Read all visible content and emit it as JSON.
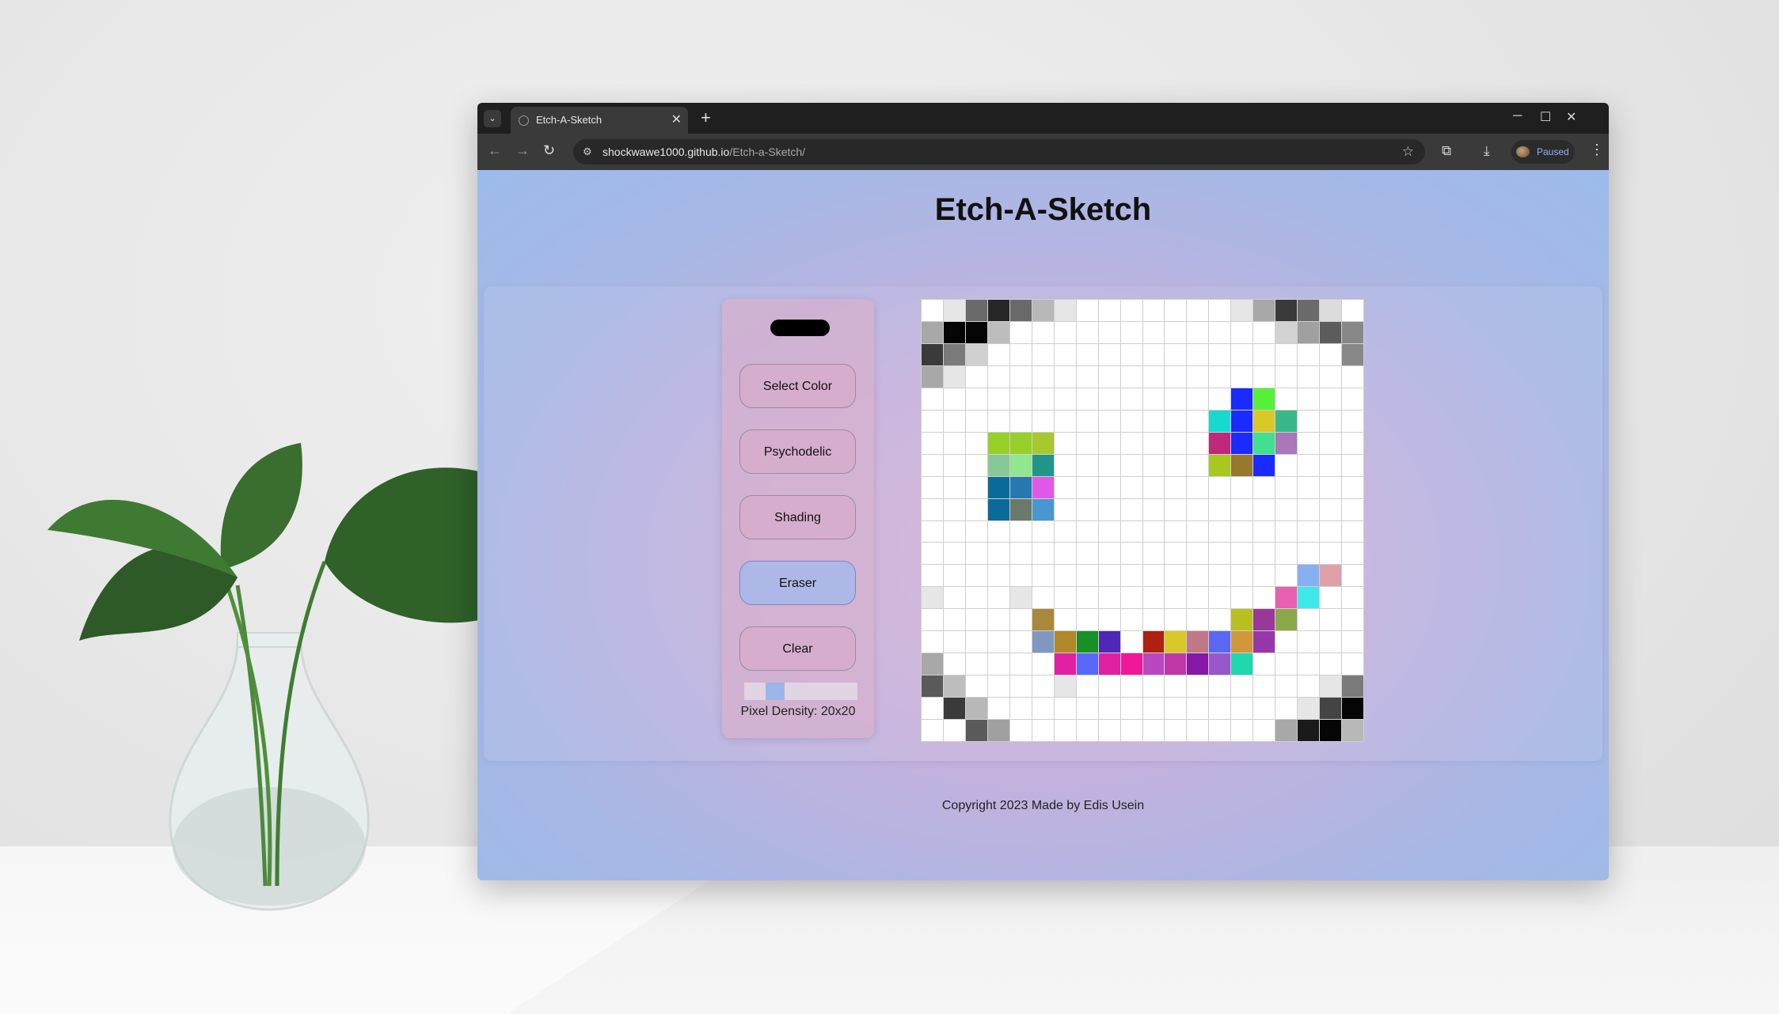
{
  "browser": {
    "tab_title": "Etch-A-Sketch",
    "url_host": "shockwawe1000.github.io",
    "url_path": "/Etch-a-Sketch/",
    "profile_label": "Paused"
  },
  "page": {
    "title": "Etch-A-Sketch",
    "current_color": "#000000",
    "buttons": {
      "select_color": "Select Color",
      "psychodelic": "Psychodelic",
      "shading": "Shading",
      "eraser": "Eraser",
      "clear": "Clear"
    },
    "active_mode": "Eraser",
    "slider_value": 20,
    "density_label": "Pixel Density: 20x20",
    "footer": "Copyright 2023 Made by Edis Usein"
  },
  "grid": {
    "size": 20,
    "cells": [
      [
        "r0",
        "c0",
        "#ffffff"
      ],
      [
        "r0",
        "c1",
        "#e6e6e6"
      ],
      [
        "r0",
        "c2",
        "#6a6a6a"
      ],
      [
        "r0",
        "c3",
        "#262626"
      ],
      [
        "r0",
        "c4",
        "#6a6a6a"
      ],
      [
        "r0",
        "c5",
        "#b8b8b8"
      ],
      [
        "r0",
        "c6",
        "#e6e6e6"
      ],
      [
        "r0",
        "c14",
        "#e6e6e6"
      ],
      [
        "r0",
        "c15",
        "#a8a8a8"
      ],
      [
        "r0",
        "c16",
        "#3a3a3a"
      ],
      [
        "r0",
        "c17",
        "#6a6a6a"
      ],
      [
        "r0",
        "c18",
        "#dcdcdc"
      ],
      [
        "r1",
        "c0",
        "#a8a8a8"
      ],
      [
        "r1",
        "c1",
        "#050505"
      ],
      [
        "r1",
        "c2",
        "#050505"
      ],
      [
        "r1",
        "c3",
        "#bdbdbd"
      ],
      [
        "r1",
        "c16",
        "#d2d2d2"
      ],
      [
        "r1",
        "c17",
        "#a0a0a0"
      ],
      [
        "r1",
        "c18",
        "#5c5c5c"
      ],
      [
        "r1",
        "c19",
        "#888888"
      ],
      [
        "r2",
        "c0",
        "#3a3a3a"
      ],
      [
        "r2",
        "c1",
        "#7a7a7a"
      ],
      [
        "r2",
        "c2",
        "#d0d0d0"
      ],
      [
        "r2",
        "c19",
        "#888888"
      ],
      [
        "r3",
        "c0",
        "#a8a8a8"
      ],
      [
        "r3",
        "c1",
        "#e6e6e6"
      ],
      [
        "r4",
        "c14",
        "#1a2bff"
      ],
      [
        "r4",
        "c15",
        "#57f03a"
      ],
      [
        "r5",
        "c13",
        "#18d8d0"
      ],
      [
        "r5",
        "c14",
        "#1a2bff"
      ],
      [
        "r5",
        "c15",
        "#d8c828"
      ],
      [
        "r5",
        "c16",
        "#3ab88a"
      ],
      [
        "r6",
        "c3",
        "#98d02a"
      ],
      [
        "r6",
        "c4",
        "#98d02a"
      ],
      [
        "r6",
        "c5",
        "#a8c830"
      ],
      [
        "r6",
        "c13",
        "#c0287a"
      ],
      [
        "r6",
        "c14",
        "#1a2bff"
      ],
      [
        "r6",
        "c15",
        "#40e090"
      ],
      [
        "r6",
        "c16",
        "#a878b8"
      ],
      [
        "r7",
        "c3",
        "#88c898"
      ],
      [
        "r7",
        "c4",
        "#90e890"
      ],
      [
        "r7",
        "c5",
        "#20968a"
      ],
      [
        "r7",
        "c13",
        "#a8c820"
      ],
      [
        "r7",
        "c14",
        "#98782a"
      ],
      [
        "r7",
        "c15",
        "#1a2bff"
      ],
      [
        "r8",
        "c3",
        "#0a6a9a"
      ],
      [
        "r8",
        "c4",
        "#2878b0"
      ],
      [
        "r8",
        "c5",
        "#e058e8"
      ],
      [
        "r9",
        "c3",
        "#0a6a9a"
      ],
      [
        "r9",
        "c4",
        "#6a7a6a"
      ],
      [
        "r9",
        "c5",
        "#4898d0"
      ],
      [
        "r12",
        "c17",
        "#88b0f0"
      ],
      [
        "r12",
        "c18",
        "#e0a0a8"
      ],
      [
        "r13",
        "c0",
        "#e6e6e6"
      ],
      [
        "r13",
        "c4",
        "#e6e6e6"
      ],
      [
        "r13",
        "c16",
        "#e860b0"
      ],
      [
        "r13",
        "c17",
        "#40e8e8"
      ],
      [
        "r14",
        "c5",
        "#a8883a"
      ],
      [
        "r14",
        "c14",
        "#b8c020"
      ],
      [
        "r14",
        "c15",
        "#9a389a"
      ],
      [
        "r14",
        "c16",
        "#8aa848"
      ],
      [
        "r15",
        "c5",
        "#8098c0"
      ],
      [
        "r15",
        "c6",
        "#b0882a"
      ],
      [
        "r15",
        "c7",
        "#189028"
      ],
      [
        "r15",
        "c8",
        "#5028b8"
      ],
      [
        "r15",
        "c10",
        "#b02010"
      ],
      [
        "r15",
        "c11",
        "#d8c828"
      ],
      [
        "r15",
        "c12",
        "#c07888"
      ],
      [
        "r15",
        "c13",
        "#5868f0"
      ],
      [
        "r15",
        "c14",
        "#d09838"
      ],
      [
        "r15",
        "c15",
        "#9838a8"
      ],
      [
        "r16",
        "c0",
        "#a8a8a8"
      ],
      [
        "r16",
        "c6",
        "#e020a0"
      ],
      [
        "r16",
        "c7",
        "#5868f8"
      ],
      [
        "r16",
        "c8",
        "#e020a0"
      ],
      [
        "r16",
        "c9",
        "#f01898"
      ],
      [
        "r16",
        "c10",
        "#b848c0"
      ],
      [
        "r16",
        "c11",
        "#c038a8"
      ],
      [
        "r16",
        "c12",
        "#8818a8"
      ],
      [
        "r16",
        "c13",
        "#9858c8"
      ],
      [
        "r16",
        "c14",
        "#20d8b0"
      ],
      [
        "r17",
        "c0",
        "#5a5a5a"
      ],
      [
        "r17",
        "c1",
        "#bdbdbd"
      ],
      [
        "r17",
        "c6",
        "#e6e6e6"
      ],
      [
        "r17",
        "c18",
        "#e6e6e6"
      ],
      [
        "r17",
        "c19",
        "#7a7a7a"
      ],
      [
        "r18",
        "c1",
        "#3a3a3a"
      ],
      [
        "r18",
        "c2",
        "#b8b8b8"
      ],
      [
        "r18",
        "c17",
        "#e6e6e6"
      ],
      [
        "r18",
        "c18",
        "#444444"
      ],
      [
        "r18",
        "c19",
        "#050505"
      ],
      [
        "r19",
        "c2",
        "#5a5a5a"
      ],
      [
        "r19",
        "c3",
        "#a0a0a0"
      ],
      [
        "r19",
        "c16",
        "#a8a8a8"
      ],
      [
        "r19",
        "c17",
        "#1a1a1a"
      ],
      [
        "r19",
        "c18",
        "#050505"
      ],
      [
        "r19",
        "c19",
        "#b8b8b8"
      ]
    ]
  }
}
